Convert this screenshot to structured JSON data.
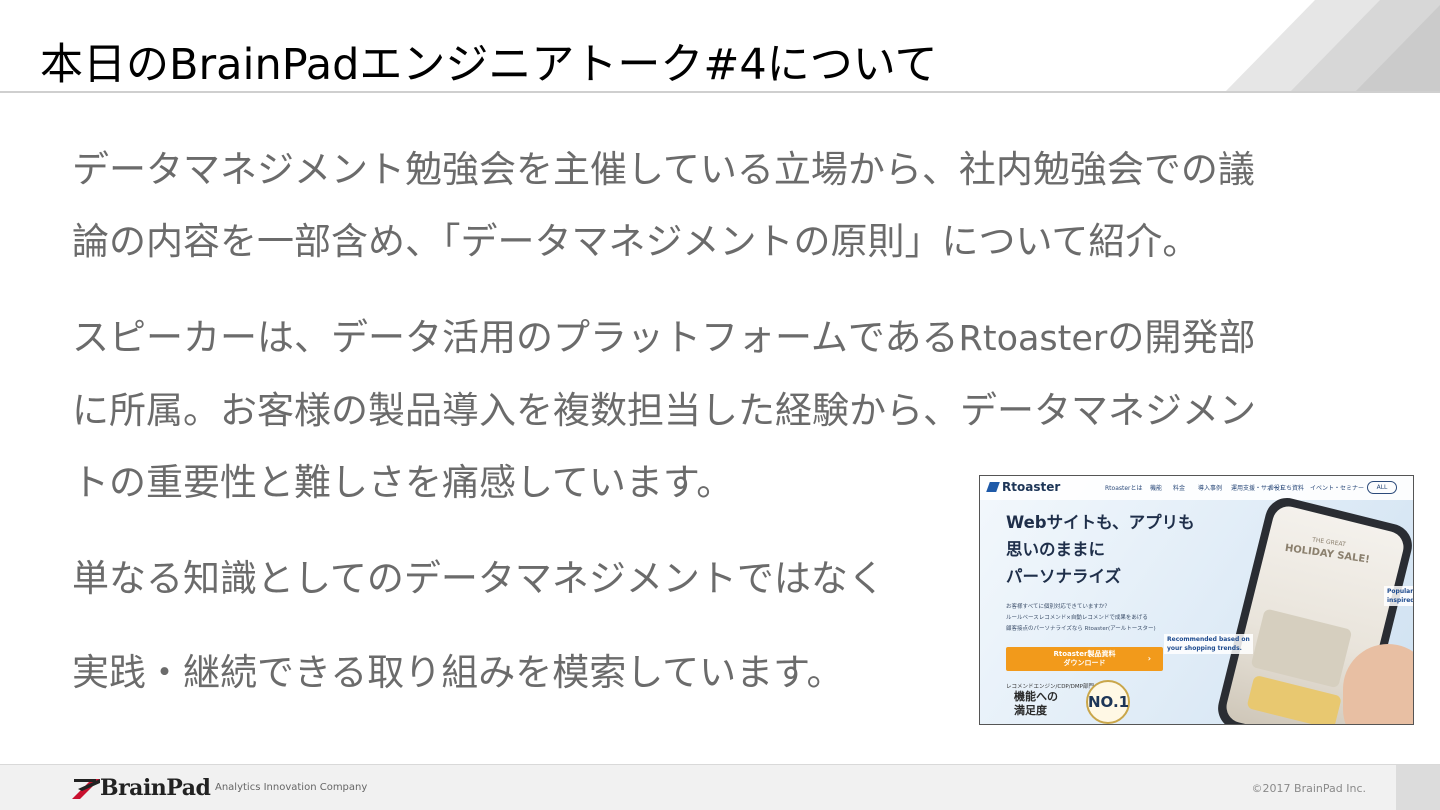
{
  "slide": {
    "title": "本日のBrainPadエンジニアトーク#4について"
  },
  "body": {
    "p1_line1": "データマネジメント勉強会を主催している立場から、社内勉強会での議",
    "p1_line2": "論の内容を一部含め、「データマネジメントの原則」について紹介。",
    "p2_line1_a": "スピーカーは、データ活用のプラットフォームである",
    "p2_line1_brand": "Rtoaster",
    "p2_line1_b": "の開発部",
    "p2_line2": "に所属。お客様の製品導入を複数担当した経験から、データマネジメン",
    "p2_line3": "トの重要性と難しさを痛感しています。",
    "p3": "単なる知識としてのデータマネジメントではなく",
    "p4": "実践・継続できる取り組みを模索しています。"
  },
  "screenshot": {
    "logo": "Rtoaster",
    "nav": [
      "Rtoasterとは",
      "機能",
      "料金",
      "導入事例",
      "運用支援・サポート",
      "お役立ち資料",
      "イベント・セミナー"
    ],
    "nav_button": "ALL",
    "headline_1": "Webサイトも、アプリも",
    "headline_2": "思いのままに",
    "headline_3": "パーソナライズ",
    "sub_1": "お客様すべてに個別対応できていますか？",
    "sub_2": "ルールベースレコメンド×自動レコメンドで成果をあげる",
    "sub_3": "顧客接点のパーソナライズなら Rtoaster(アールトースター)",
    "cta_1": "Rtoaster製品資料",
    "cta_2": "ダウンロード",
    "cta_arrow": "›",
    "award_category": "レコメンドエンジン/CDP/DMP部門",
    "award_1": "機能への",
    "award_2": "満足度",
    "award_medal": "NO.1",
    "phone_promo_small": "THE GREAT",
    "phone_promo": "HOLIDAY SALE!",
    "callout_1": "Recommended based on",
    "callout_2": "your shopping trends.",
    "callout_right_1": "Popular g",
    "callout_right_2": "inspired"
  },
  "footer": {
    "logo_text": "BrainPad",
    "tagline": "Analytics Innovation Company",
    "copyright": "©2017 BrainPad Inc."
  },
  "colors": {
    "body_text": "#6b6b6b",
    "cta_orange": "#f29a1b",
    "brand_red": "#c8102e"
  }
}
